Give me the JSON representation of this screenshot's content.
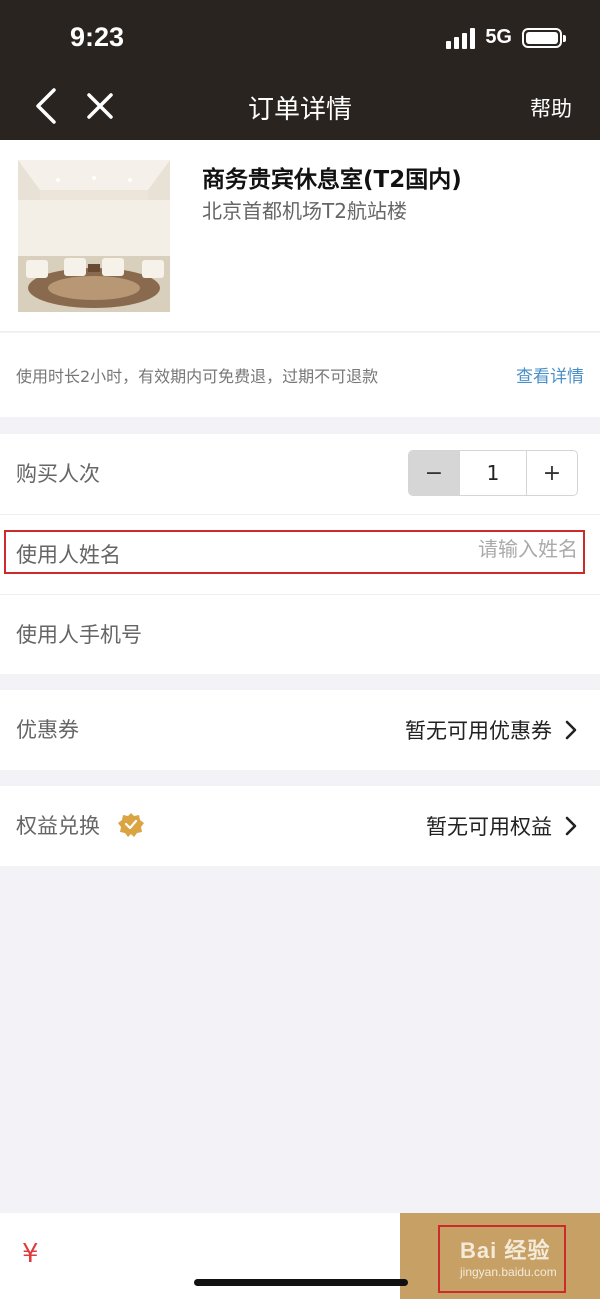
{
  "status": {
    "time": "9:23",
    "network": "5G"
  },
  "nav": {
    "title": "订单详情",
    "help": "帮助",
    "back_icon": "chevron-left-icon",
    "close_icon": "close-icon"
  },
  "product": {
    "name": "商务贵宾休息室(T2国内)",
    "location": "北京首都机场T2航站楼"
  },
  "policy": {
    "text": "使用时长2小时，有效期内可免费退，过期不可退款",
    "link": "查看详情"
  },
  "form": {
    "quantity_label": "购买人次",
    "quantity_value": "1",
    "minus": "−",
    "plus": "+",
    "name_label": "使用人姓名",
    "name_placeholder": "请输入姓名",
    "phone_label": "使用人手机号"
  },
  "coupon": {
    "label": "优惠券",
    "value": "暂无可用优惠券"
  },
  "benefit": {
    "label": "权益兑换",
    "value": "暂无可用权益"
  },
  "footer": {
    "currency": "¥",
    "watermark": "Bai 经验",
    "watermark_sub": "jingyan.baidu.com"
  },
  "colors": {
    "header_bg": "#2a2420",
    "accent_gold": "#c7a066",
    "link_blue": "#4a90c8",
    "price_red": "#e03a3a",
    "highlight_red": "#cc2b2b"
  }
}
